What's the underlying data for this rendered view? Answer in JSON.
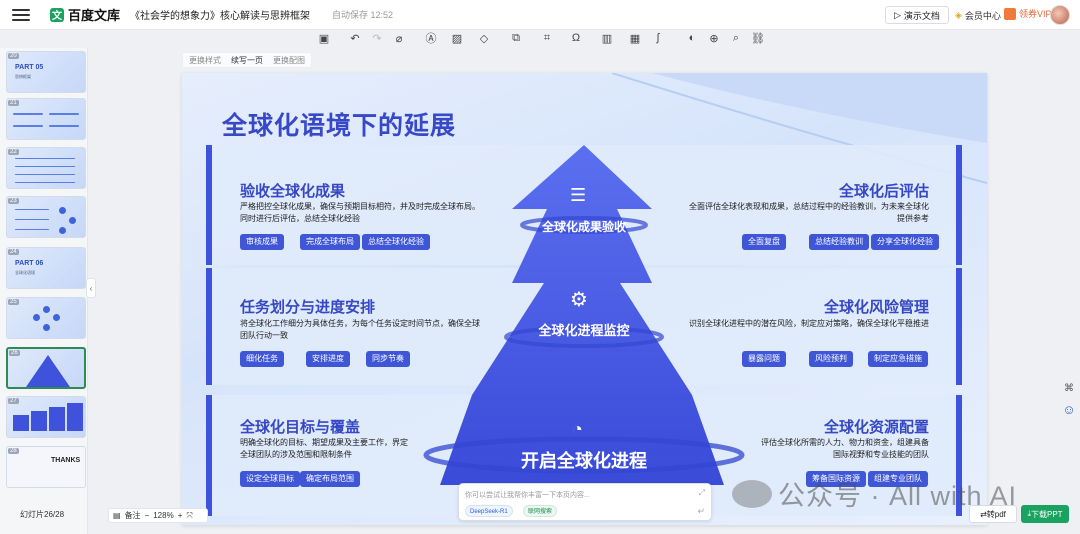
{
  "app": {
    "brand": "百度文库",
    "doc_title": "《社会学的想象力》核心解读与思辨框架",
    "autosave": "自动保存 12:52"
  },
  "header": {
    "present_label": "演示文档",
    "member_label": "会员中心",
    "vip_label": "领券VIP"
  },
  "edit_bar": {
    "items": [
      "更换样式",
      "续写一页",
      "更换配图"
    ]
  },
  "sidebar": {
    "slides": [
      {
        "num": "20",
        "title": "PART 05",
        "subtitle": "思辨框架"
      },
      {
        "num": "21",
        "title": "",
        "subtitle": ""
      },
      {
        "num": "22",
        "title": "",
        "subtitle": ""
      },
      {
        "num": "23",
        "title": "",
        "subtitle": ""
      },
      {
        "num": "24",
        "title": "PART 06",
        "subtitle": "全球化语境"
      },
      {
        "num": "25",
        "title": "",
        "subtitle": ""
      },
      {
        "num": "26",
        "title": "",
        "subtitle": ""
      },
      {
        "num": "27",
        "title": "",
        "subtitle": ""
      },
      {
        "num": "28",
        "title": "THANKS",
        "subtitle": ""
      }
    ],
    "count_label": "幻灯片26/28"
  },
  "slide": {
    "title": "全球化语境下的延展",
    "sections": {
      "tl": {
        "heading": "验收全球化成果",
        "desc": "严格把控全球化成果，确保与预期目标相符，并及时完成全球布局。同时进行后评估，总结全球化经验",
        "tags": [
          "审核成果",
          "完成全球布局",
          "总结全球化经验"
        ]
      },
      "tr": {
        "heading": "全球化后评估",
        "desc": "全面评估全球化表现和成果，总结过程中的经验教训，为未来全球化提供参考",
        "tags": [
          "全面复盘",
          "总结经验教训",
          "分享全球化经验"
        ]
      },
      "ml": {
        "heading": "任务划分与进度安排",
        "desc": "将全球化工作细分为具体任务，为每个任务设定时间节点，确保全球团队行动一致",
        "tags": [
          "细化任务",
          "安排进度",
          "同步节奏"
        ]
      },
      "mr": {
        "heading": "全球化风险管理",
        "desc": "识别全球化进程中的潜在风险，制定应对策略，确保全球化平稳推进",
        "tags": [
          "暴露问题",
          "风险预判",
          "制定应急措施"
        ]
      },
      "bl": {
        "heading": "全球化目标与覆盖",
        "desc": "明确全球化的目标、期望成果及主要工作，界定全球团队的涉及范围和限制条件",
        "tags": [
          "设定全球目标",
          "确定布局范围"
        ]
      },
      "br": {
        "heading": "全球化资源配置",
        "desc": "评估全球化所需的人力、物力和资金，组建具备国际视野和专业技能的团队",
        "tags": [
          "筹备国际资源",
          "组建专业团队"
        ]
      }
    },
    "pyramid": {
      "top": "全球化成果验收",
      "mid": "全球化进程监控",
      "base": "开启全球化进程"
    }
  },
  "chat": {
    "placeholder": "你可以尝试让我帮你丰富一下本页内容...",
    "chips": [
      "DeepSeek-R1",
      "联网搜索"
    ]
  },
  "bottom": {
    "notes_label": "备注",
    "zoom": "128%",
    "to_pdf": "转pdf",
    "download_ppt": "下载PPT"
  },
  "watermark": "公众号 · All with AI",
  "colors": {
    "accent": "#3f52dc",
    "title": "#3749c8",
    "green": "#1aa260"
  }
}
